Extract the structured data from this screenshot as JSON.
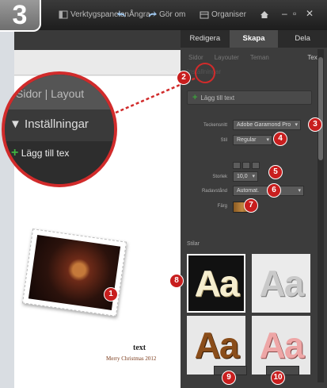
{
  "step_number": "3",
  "topbar": {
    "items": [
      {
        "label": "Verktygspanelen",
        "icon": "panel-icon"
      },
      {
        "label": "Ångra",
        "icon": "undo-icon"
      },
      {
        "label": "Gör om",
        "icon": "redo-icon"
      },
      {
        "label": "Organiser",
        "icon": "organizer-icon"
      },
      {
        "label": "",
        "icon": "home-icon"
      }
    ],
    "window_controls": [
      "–",
      "▫",
      "✕"
    ]
  },
  "panel": {
    "tabs": [
      "Redigera",
      "Skapa",
      "Dela"
    ],
    "active_tab": "Skapa",
    "subtabs": [
      "Sidor",
      "Layouter",
      "Teman",
      "Text"
    ],
    "settings_header": "Inställningar",
    "add_text_button": "Lägg till text",
    "font_label": "Teckensnitt",
    "font_value": "Adobe Garamond Pro",
    "style_label": "Stil",
    "style_value": "Regular",
    "size_label": "Storlek",
    "size_value": "10,0",
    "leading_label": "Radavstånd",
    "leading_value": "Automat.",
    "color_label": "Färg",
    "styles_header": "Stilar",
    "style_tiles": [
      "Aa",
      "Aa",
      "Aa",
      "Aa"
    ]
  },
  "canvas": {
    "title": "text",
    "subtitle": "Merry Christmas 2012"
  },
  "magnifier": {
    "row1": "Sidor  |  Layout",
    "row2": "Inställningar",
    "row3": "Lägg till tex"
  },
  "annotations": [
    "1",
    "2",
    "3",
    "4",
    "5",
    "6",
    "7",
    "8",
    "9",
    "10"
  ],
  "colors": {
    "annotation_red": "#c81e1e",
    "panel_bg": "#3c3c3c",
    "plus_green": "#3da03d"
  }
}
